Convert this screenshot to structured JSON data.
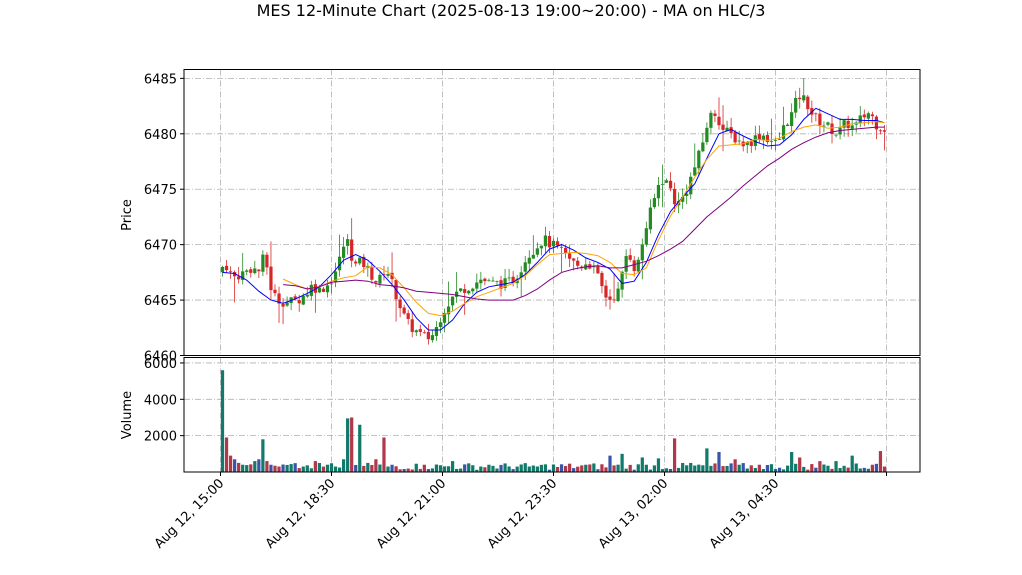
{
  "chart_data": {
    "type": "candlestick",
    "title": "MES 12-Minute Chart (2025-08-13 19:00~20:00) - MA on HLC/3",
    "price_panel": {
      "ylabel": "Price",
      "ylim": [
        6460,
        6485.8
      ],
      "yticks": [
        6460,
        6465,
        6470,
        6475,
        6480,
        6485
      ],
      "ytick_labels": [
        "6460",
        "6465",
        "6470",
        "6475",
        "6480",
        "6485"
      ],
      "grid": true,
      "ma_series": [
        {
          "color": "#0000ff",
          "points": [
            [
              0,
              6467.5
            ],
            [
              3,
              6467.4
            ],
            [
              6,
              6466.8
            ],
            [
              9,
              6465.8
            ],
            [
              12,
              6465.0
            ],
            [
              15,
              6464.7
            ],
            [
              18,
              6465.1
            ],
            [
              21,
              6465.6
            ],
            [
              24,
              6466.2
            ],
            [
              27,
              6467.3
            ],
            [
              30,
              6468.6
            ],
            [
              33,
              6469.1
            ],
            [
              36,
              6468.6
            ],
            [
              39,
              6467.6
            ],
            [
              42,
              6466.4
            ],
            [
              45,
              6465.0
            ],
            [
              48,
              6463.4
            ],
            [
              51,
              6462.3
            ],
            [
              54,
              6462.3
            ],
            [
              57,
              6463.2
            ],
            [
              60,
              6464.7
            ],
            [
              63,
              6465.7
            ],
            [
              66,
              6466.2
            ],
            [
              69,
              6466.4
            ],
            [
              72,
              6466.6
            ],
            [
              75,
              6467.3
            ],
            [
              78,
              6468.4
            ],
            [
              81,
              6469.6
            ],
            [
              84,
              6470.0
            ],
            [
              87,
              6469.5
            ],
            [
              90,
              6468.8
            ],
            [
              93,
              6468.4
            ],
            [
              96,
              6467.8
            ],
            [
              99,
              6466.5
            ],
            [
              102,
              6466.7
            ],
            [
              105,
              6468.4
            ],
            [
              108,
              6470.9
            ],
            [
              111,
              6473.0
            ],
            [
              114,
              6474.3
            ],
            [
              117,
              6475.5
            ],
            [
              120,
              6477.8
            ],
            [
              123,
              6480.0
            ],
            [
              126,
              6480.4
            ],
            [
              129,
              6479.8
            ],
            [
              132,
              6479.3
            ],
            [
              135,
              6478.9
            ],
            [
              138,
              6479.0
            ],
            [
              141,
              6479.9
            ],
            [
              144,
              6481.3
            ],
            [
              147,
              6482.3
            ],
            [
              150,
              6481.8
            ],
            [
              153,
              6481.3
            ],
            [
              156,
              6481.3
            ],
            [
              159,
              6481.2
            ],
            [
              162,
              6481.2
            ],
            [
              164,
              6481.0
            ]
          ]
        },
        {
          "color": "#ffa500",
          "points": [
            [
              15,
              6466.9
            ],
            [
              18,
              6466.4
            ],
            [
              21,
              6466.0
            ],
            [
              24,
              6466.2
            ],
            [
              27,
              6466.7
            ],
            [
              30,
              6467.0
            ],
            [
              33,
              6467.2
            ],
            [
              36,
              6468.0
            ],
            [
              39,
              6467.9
            ],
            [
              42,
              6467.3
            ],
            [
              45,
              6466.1
            ],
            [
              48,
              6464.8
            ],
            [
              51,
              6463.8
            ],
            [
              54,
              6463.6
            ],
            [
              57,
              6464.0
            ],
            [
              60,
              6464.7
            ],
            [
              63,
              6465.3
            ],
            [
              66,
              6465.7
            ],
            [
              69,
              6466.1
            ],
            [
              72,
              6466.5
            ],
            [
              75,
              6467.2
            ],
            [
              78,
              6468.2
            ],
            [
              81,
              6469.1
            ],
            [
              84,
              6469.2
            ],
            [
              87,
              6469.3
            ],
            [
              90,
              6469.2
            ],
            [
              93,
              6469.0
            ],
            [
              96,
              6468.4
            ],
            [
              99,
              6467.4
            ],
            [
              102,
              6467.3
            ],
            [
              105,
              6467.9
            ],
            [
              108,
              6470.4
            ],
            [
              111,
              6472.6
            ],
            [
              114,
              6474.3
            ],
            [
              117,
              6476.1
            ],
            [
              120,
              6477.7
            ],
            [
              123,
              6478.9
            ],
            [
              126,
              6479.0
            ],
            [
              129,
              6479.1
            ],
            [
              132,
              6479.5
            ],
            [
              135,
              6479.4
            ],
            [
              138,
              6479.6
            ],
            [
              141,
              6480.2
            ],
            [
              144,
              6480.6
            ],
            [
              147,
              6480.8
            ],
            [
              150,
              6480.5
            ],
            [
              153,
              6480.6
            ],
            [
              156,
              6480.9
            ],
            [
              159,
              6481.0
            ],
            [
              162,
              6481.1
            ],
            [
              164,
              6481.0
            ]
          ]
        },
        {
          "color": "#800080",
          "points": [
            [
              15,
              6466.4
            ],
            [
              18,
              6466.3
            ],
            [
              21,
              6466.0
            ],
            [
              24,
              6466.2
            ],
            [
              27,
              6466.6
            ],
            [
              30,
              6466.7
            ],
            [
              33,
              6466.8
            ],
            [
              36,
              6466.7
            ],
            [
              39,
              6466.4
            ],
            [
              42,
              6466.3
            ],
            [
              45,
              6466.1
            ],
            [
              48,
              6465.8
            ],
            [
              51,
              6465.7
            ],
            [
              54,
              6465.6
            ],
            [
              57,
              6465.5
            ],
            [
              60,
              6465.3
            ],
            [
              63,
              6465.1
            ],
            [
              66,
              6465.0
            ],
            [
              69,
              6465.0
            ],
            [
              72,
              6465.0
            ],
            [
              75,
              6465.4
            ],
            [
              78,
              6466.0
            ],
            [
              81,
              6466.8
            ],
            [
              84,
              6467.5
            ],
            [
              87,
              6467.8
            ],
            [
              90,
              6468.0
            ],
            [
              93,
              6468.1
            ],
            [
              96,
              6467.9
            ],
            [
              99,
              6467.9
            ],
            [
              102,
              6468.2
            ],
            [
              105,
              6468.5
            ],
            [
              108,
              6469.0
            ],
            [
              111,
              6469.6
            ],
            [
              114,
              6470.3
            ],
            [
              117,
              6471.4
            ],
            [
              120,
              6472.5
            ],
            [
              123,
              6473.4
            ],
            [
              126,
              6474.3
            ],
            [
              129,
              6475.3
            ],
            [
              132,
              6476.2
            ],
            [
              135,
              6477.1
            ],
            [
              138,
              6477.8
            ],
            [
              141,
              6478.6
            ],
            [
              144,
              6479.2
            ],
            [
              147,
              6479.7
            ],
            [
              150,
              6480.1
            ],
            [
              153,
              6480.3
            ],
            [
              156,
              6480.4
            ],
            [
              159,
              6480.5
            ],
            [
              162,
              6480.6
            ],
            [
              164,
              6480.6
            ]
          ]
        }
      ]
    },
    "volume_panel": {
      "ylabel": "Volume",
      "ylim": [
        0,
        6300
      ],
      "yticks": [
        2000,
        4000,
        6000
      ],
      "ytick_labels": [
        "2000",
        "4000",
        "6000"
      ],
      "grid": true
    },
    "x_axis": {
      "bars": 165,
      "ticks": [
        {
          "index": 0,
          "label": "Aug 12, 15:00"
        },
        {
          "index": 27.5,
          "label": "Aug 12, 18:30"
        },
        {
          "index": 55,
          "label": "Aug 12, 21:00"
        },
        {
          "index": 82.5,
          "label": "Aug 12, 23:30"
        },
        {
          "index": 110,
          "label": "Aug 13, 02:00"
        },
        {
          "index": 137.5,
          "label": "Aug 13, 04:30"
        },
        {
          "index": 165,
          "label": ""
        }
      ]
    },
    "close_path": [
      [
        0,
        6467.5
      ],
      [
        1,
        6468.5
      ],
      [
        3,
        6467.0
      ],
      [
        6,
        6467.5
      ],
      [
        8,
        6468.0
      ],
      [
        9,
        6467.5
      ],
      [
        10,
        6467.8
      ],
      [
        11,
        6469.5
      ],
      [
        12,
        6466.5
      ],
      [
        14,
        6465.0
      ],
      [
        17,
        6464.8
      ],
      [
        19,
        6465.0
      ],
      [
        21,
        6465.5
      ],
      [
        23,
        6466.5
      ],
      [
        24,
        6465.8
      ],
      [
        27,
        6466.5
      ],
      [
        29,
        6468.0
      ],
      [
        31,
        6470.5
      ],
      [
        32,
        6470.0
      ],
      [
        33,
        6468.0
      ],
      [
        35,
        6468.5
      ],
      [
        37,
        6467.5
      ],
      [
        39,
        6466.5
      ],
      [
        41,
        6468.0
      ],
      [
        42,
        6467.0
      ],
      [
        44,
        6465.0
      ],
      [
        46,
        6463.0
      ],
      [
        49,
        6462.0
      ],
      [
        51,
        6461.5
      ],
      [
        53,
        6462.0
      ],
      [
        55,
        6464.0
      ],
      [
        58,
        6465.5
      ],
      [
        60,
        6466.0
      ],
      [
        63,
        6466.5
      ],
      [
        65,
        6467.0
      ],
      [
        66,
        6466.5
      ],
      [
        69,
        6466.5
      ],
      [
        71,
        6466.5
      ],
      [
        73,
        6467.0
      ],
      [
        76,
        6469.0
      ],
      [
        80,
        6470.5
      ],
      [
        82,
        6470.0
      ],
      [
        84,
        6469.5
      ],
      [
        87,
        6468.5
      ],
      [
        89,
        6468.0
      ],
      [
        91,
        6468.5
      ],
      [
        93,
        6467.5
      ],
      [
        94,
        6466.5
      ],
      [
        96,
        6465.0
      ],
      [
        98,
        6465.5
      ],
      [
        99,
        6466.0
      ],
      [
        100,
        6468.5
      ],
      [
        101,
        6469.5
      ],
      [
        103,
        6467.5
      ],
      [
        105,
        6471.0
      ],
      [
        107,
        6473.5
      ],
      [
        109,
        6476.0
      ],
      [
        111,
        6475.5
      ],
      [
        113,
        6473.5
      ],
      [
        115,
        6474.5
      ],
      [
        117,
        6476.5
      ],
      [
        119,
        6478.5
      ],
      [
        121,
        6481.5
      ],
      [
        123,
        6482.0
      ],
      [
        124,
        6480.5
      ],
      [
        126,
        6480.0
      ],
      [
        128,
        6479.5
      ],
      [
        130,
        6479.0
      ],
      [
        132,
        6479.5
      ],
      [
        134,
        6480.0
      ],
      [
        136,
        6479.5
      ],
      [
        138,
        6479.0
      ],
      [
        140,
        6481.0
      ],
      [
        142,
        6482.0
      ],
      [
        143,
        6483.5
      ],
      [
        145,
        6483.0
      ],
      [
        147,
        6481.5
      ],
      [
        149,
        6481.0
      ],
      [
        151,
        6480.5
      ],
      [
        153,
        6480.0
      ],
      [
        155,
        6481.0
      ],
      [
        157,
        6480.5
      ],
      [
        159,
        6481.5
      ],
      [
        161,
        6482.0
      ],
      [
        162,
        6481.0
      ],
      [
        164,
        6480.5
      ]
    ],
    "volume_peaks": [
      [
        0,
        5600
      ],
      [
        1,
        1900
      ],
      [
        2,
        900
      ],
      [
        3,
        700
      ],
      [
        4,
        500
      ],
      [
        5,
        400
      ],
      [
        6,
        380
      ],
      [
        7,
        420
      ],
      [
        8,
        600
      ],
      [
        9,
        700
      ],
      [
        10,
        1800
      ],
      [
        11,
        600
      ],
      [
        12,
        400
      ],
      [
        14,
        300
      ],
      [
        20,
        300
      ],
      [
        23,
        600
      ],
      [
        26,
        400
      ],
      [
        28,
        300
      ],
      [
        30,
        700
      ],
      [
        31,
        2950
      ],
      [
        32,
        3000
      ],
      [
        34,
        2600
      ],
      [
        36,
        500
      ],
      [
        38,
        700
      ],
      [
        40,
        1900
      ],
      [
        42,
        400
      ],
      [
        50,
        400
      ],
      [
        57,
        600
      ],
      [
        66,
        400
      ],
      [
        76,
        300
      ],
      [
        90,
        400
      ],
      [
        96,
        900
      ],
      [
        99,
        1000
      ],
      [
        104,
        800
      ],
      [
        108,
        750
      ],
      [
        112,
        1850
      ],
      [
        116,
        500
      ],
      [
        120,
        1300
      ],
      [
        123,
        1100
      ],
      [
        127,
        700
      ],
      [
        133,
        400
      ],
      [
        141,
        1100
      ],
      [
        143,
        800
      ],
      [
        148,
        600
      ],
      [
        152,
        600
      ],
      [
        156,
        900
      ],
      [
        161,
        400
      ],
      [
        163,
        1150
      ],
      [
        164,
        300
      ]
    ]
  }
}
